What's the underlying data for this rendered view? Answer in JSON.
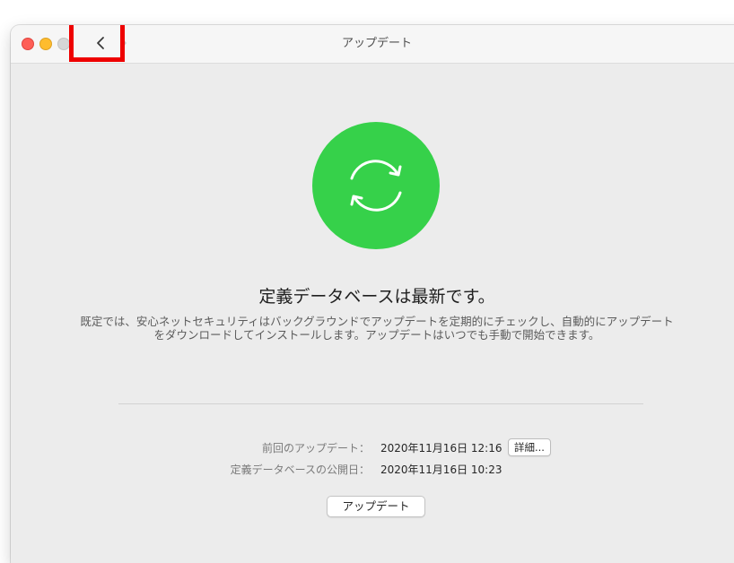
{
  "window": {
    "title": "アップデート"
  },
  "icons": {
    "back": "chevron-left-icon",
    "forward": "chevron-right-icon",
    "status": "sync-icon"
  },
  "colors": {
    "status_green": "#36d14a",
    "highlight_red": "#ee0000",
    "close": "#fe5f57",
    "minimize": "#febc2e",
    "zoom": "#d6d6d6"
  },
  "main": {
    "heading": "定義データベースは最新です。",
    "description": "既定では、安心ネットセキュリティはバックグラウンドでアップデートを定期的にチェックし、自動的にアップデートをダウンロードしてインストールします。アップデートはいつでも手動で開始できます。"
  },
  "info": {
    "last_update_label": "前回のアップデート：",
    "last_update_value": "2020年11月16日 12:16",
    "details_label": "詳細...",
    "db_published_label": "定義データベースの公開日：",
    "db_published_value": "2020年11月16日 10:23"
  },
  "actions": {
    "update_label": "アップデート"
  }
}
